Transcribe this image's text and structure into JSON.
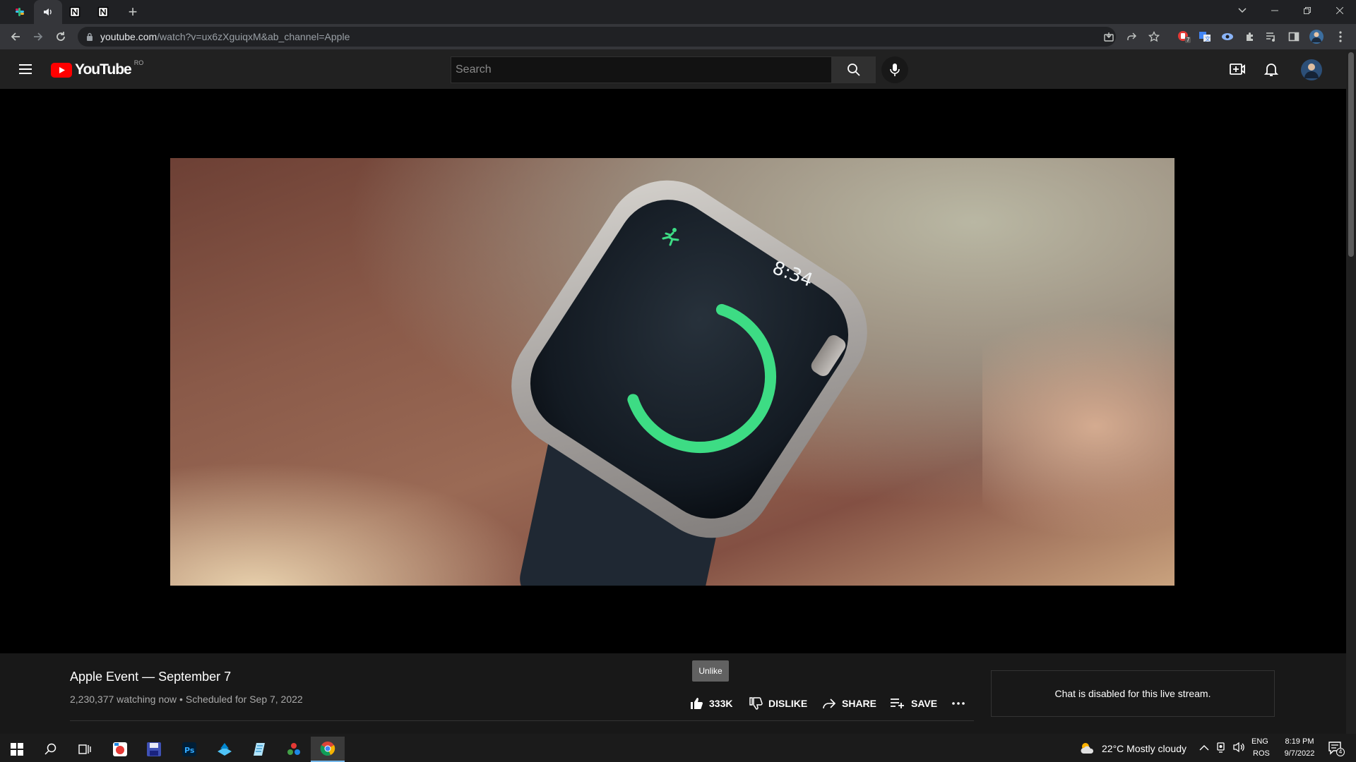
{
  "browser": {
    "url_host": "youtube.com",
    "url_path": "/watch?v=ux6zXguiqxM&ab_channel=Apple",
    "extension_badge": "7"
  },
  "youtube": {
    "logo_text": "YouTube",
    "country_code": "RO",
    "search_placeholder": "Search"
  },
  "video": {
    "watch_time": "8:34",
    "title": "Apple Event — September 7",
    "watching": "2,230,377 watching now",
    "separator": "•",
    "scheduled": "Scheduled for Sep 7, 2022",
    "tooltip": "Unlike",
    "actions": {
      "like_count": "333K",
      "dislike": "DISLIKE",
      "share": "SHARE",
      "save": "SAVE"
    },
    "chat_disabled": "Chat is disabled for this live stream."
  },
  "taskbar": {
    "weather": "22°C  Mostly cloudy",
    "lang_top": "ENG",
    "lang_bottom": "ROS",
    "time": "8:19 PM",
    "date": "9/7/2022",
    "notification_count": "4"
  },
  "colors": {
    "yt_red": "#ff0000",
    "ring_green": "#3ddc84",
    "chrome_dark": "#202124"
  }
}
